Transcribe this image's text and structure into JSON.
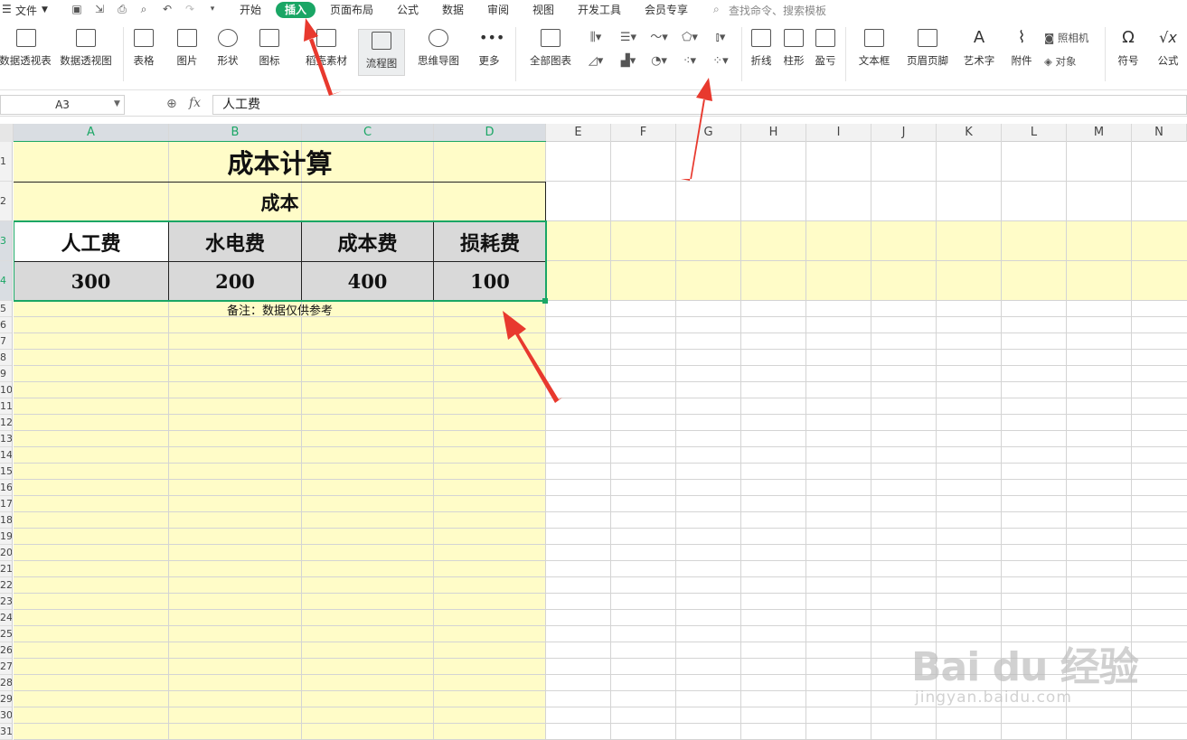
{
  "menubar": {
    "file": "文件",
    "tabs": [
      "开始",
      "插入",
      "页面布局",
      "公式",
      "数据",
      "审阅",
      "视图",
      "开发工具",
      "会员专享"
    ],
    "search": "查找命令、搜索模板"
  },
  "ribbon": {
    "buttons": [
      "数据透视表",
      "数据透视图",
      "表格",
      "图片",
      "形状",
      "图标",
      "稻壳素材",
      "流程图",
      "思维导图",
      "更多",
      "全部图表",
      "折线",
      "柱形",
      "盈亏",
      "文本框",
      "页眉页脚",
      "艺术字",
      "附件",
      "照相机",
      "对象",
      "符号",
      "公式"
    ]
  },
  "formulabar": {
    "name_box": "A3",
    "fx": "fx",
    "formula": "人工费"
  },
  "grid": {
    "columns": [
      "A",
      "B",
      "C",
      "D",
      "E",
      "F",
      "G",
      "H",
      "I",
      "J",
      "K",
      "L",
      "M",
      "N"
    ],
    "rows": [
      "1",
      "2",
      "3",
      "4",
      "5",
      "6",
      "7",
      "8",
      "9",
      "10",
      "11",
      "12",
      "13",
      "14",
      "15",
      "16",
      "17",
      "18",
      "19",
      "20",
      "21",
      "22",
      "23",
      "24",
      "25",
      "26",
      "27",
      "28",
      "29",
      "30",
      "31"
    ],
    "title": "成本计算",
    "subtitle": "成本",
    "headers": [
      "人工费",
      "水电费",
      "成本费",
      "损耗费"
    ],
    "values": [
      "300",
      "200",
      "400",
      "100"
    ],
    "note": "备注：数据仅供参考"
  },
  "colors": {
    "accent": "#1aa665",
    "yellow_fill": "#fffcc8",
    "gray_fill": "#d9d9d9",
    "arrow": "#e8392e"
  },
  "watermark": {
    "logo": "Bai du 经验",
    "url": "jingyan.baidu.com"
  }
}
